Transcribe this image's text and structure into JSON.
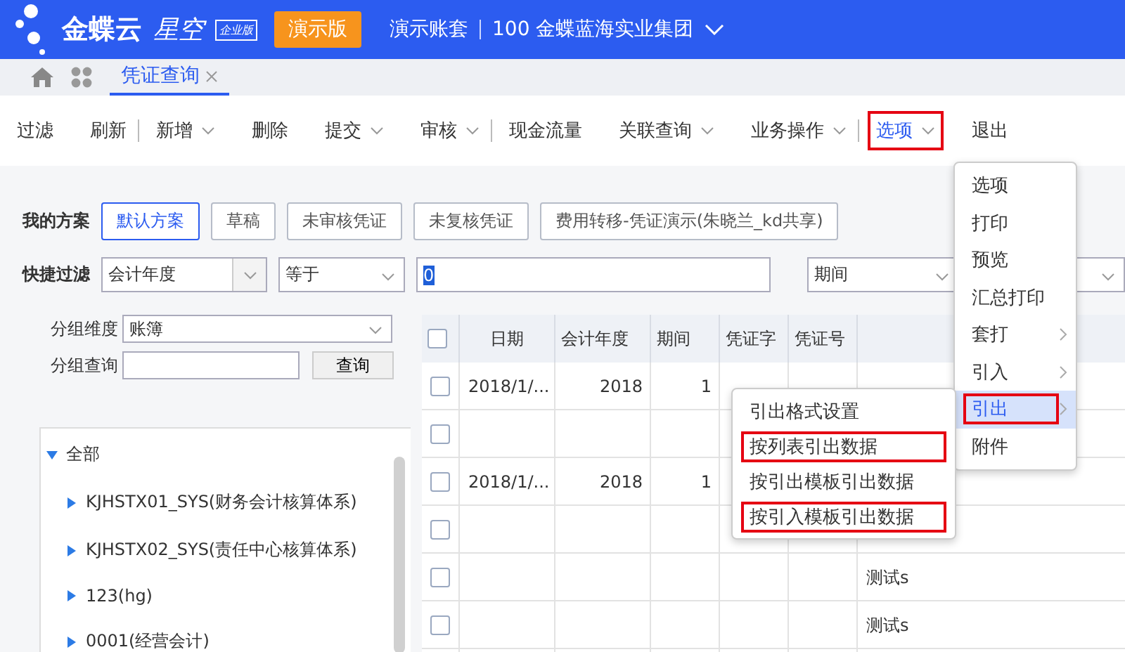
{
  "header": {
    "logo_text": "金蝶云",
    "logo_sub": "星空",
    "edition": "企业版",
    "demo_badge": "演示版",
    "account": "演示账套",
    "org": "100 金蝶蓝海实业集团"
  },
  "tabs": [
    {
      "label": "凭证查询",
      "selected": true
    }
  ],
  "toolbar": [
    {
      "kind": "button",
      "label": "过滤",
      "dropdown": false,
      "highlighted": false
    },
    {
      "kind": "button",
      "label": "刷新",
      "dropdown": false,
      "highlighted": false
    },
    {
      "kind": "divider"
    },
    {
      "kind": "button",
      "label": "新增",
      "dropdown": true,
      "highlighted": false
    },
    {
      "kind": "button",
      "label": "删除",
      "dropdown": false,
      "highlighted": false
    },
    {
      "kind": "button",
      "label": "提交",
      "dropdown": true,
      "highlighted": false
    },
    {
      "kind": "button",
      "label": "审核",
      "dropdown": true,
      "highlighted": false
    },
    {
      "kind": "divider"
    },
    {
      "kind": "button",
      "label": "现金流量",
      "dropdown": false,
      "highlighted": false
    },
    {
      "kind": "button",
      "label": "关联查询",
      "dropdown": true,
      "highlighted": false
    },
    {
      "kind": "button",
      "label": "业务操作",
      "dropdown": true,
      "highlighted": false
    },
    {
      "kind": "divider"
    },
    {
      "kind": "button",
      "label": "选项",
      "dropdown": true,
      "highlighted": true
    },
    {
      "kind": "button",
      "label": "退出",
      "dropdown": false,
      "highlighted": false
    }
  ],
  "schemes": {
    "label": "我的方案",
    "items": [
      {
        "label": "默认方案",
        "selected": true
      },
      {
        "label": "草稿",
        "selected": false
      },
      {
        "label": "未审核凭证",
        "selected": false
      },
      {
        "label": "未复核凭证",
        "selected": false
      },
      {
        "label": "费用转移-凭证演示(朱晓兰_kd共享)",
        "selected": false
      }
    ]
  },
  "quick_filter": {
    "label": "快捷过滤",
    "field": "会计年度",
    "operator": "等于",
    "value": "0",
    "second_field": "期间"
  },
  "group": {
    "dimension_label": "分组维度",
    "dimension": "账簿",
    "query_label": "分组查询",
    "query_button": "查询"
  },
  "tree": {
    "label": "全部",
    "expanded": true,
    "children": [
      {
        "label": "KJHSTX01_SYS(财务会计核算体系)",
        "expanded": false
      },
      {
        "label": "KJHSTX02_SYS(责任中心核算体系)",
        "expanded": false
      },
      {
        "label": "123(hg)",
        "expanded": false
      },
      {
        "label": "0001(经营会计)",
        "expanded": false
      }
    ]
  },
  "table": {
    "all_checked": false,
    "columns": [
      "日期",
      "会计年度",
      "期间",
      "凭证字",
      "凭证号"
    ],
    "rows": [
      {
        "checked": false,
        "cells": [
          "2018/1/...",
          "2018",
          "1",
          "",
          "",
          ""
        ]
      },
      {
        "checked": false,
        "cells": [
          "",
          "",
          "",
          "",
          "",
          ""
        ]
      },
      {
        "checked": false,
        "cells": [
          "2018/1/...",
          "2018",
          "1",
          "",
          "",
          ""
        ]
      },
      {
        "checked": false,
        "cells": [
          "",
          "",
          "",
          "",
          "",
          ""
        ]
      },
      {
        "checked": false,
        "cells": [
          "",
          "",
          "",
          "",
          "",
          "测试s"
        ]
      },
      {
        "checked": false,
        "cells": [
          "",
          "",
          "",
          "",
          "",
          "测试s"
        ]
      }
    ]
  },
  "options_menu": [
    {
      "label": "选项",
      "submenu": false,
      "selected": false,
      "highlighted": false
    },
    {
      "label": "打印",
      "submenu": false,
      "selected": false,
      "highlighted": false
    },
    {
      "label": "预览",
      "submenu": false,
      "selected": false,
      "highlighted": false
    },
    {
      "label": "汇总打印",
      "submenu": false,
      "selected": false,
      "highlighted": false
    },
    {
      "label": "套打",
      "submenu": true,
      "selected": false,
      "highlighted": false
    },
    {
      "label": "引入",
      "submenu": true,
      "selected": false,
      "highlighted": false
    },
    {
      "label": "引出",
      "submenu": true,
      "selected": true,
      "highlighted": true
    },
    {
      "label": "附件",
      "submenu": false,
      "selected": false,
      "highlighted": false
    }
  ],
  "export_submenu": [
    {
      "label": "引出格式设置",
      "highlighted": false
    },
    {
      "label": "按列表引出数据",
      "highlighted": true
    },
    {
      "label": "按引出模板引出数据",
      "highlighted": false
    },
    {
      "label": "按引入模板引出数据",
      "highlighted": true
    }
  ]
}
